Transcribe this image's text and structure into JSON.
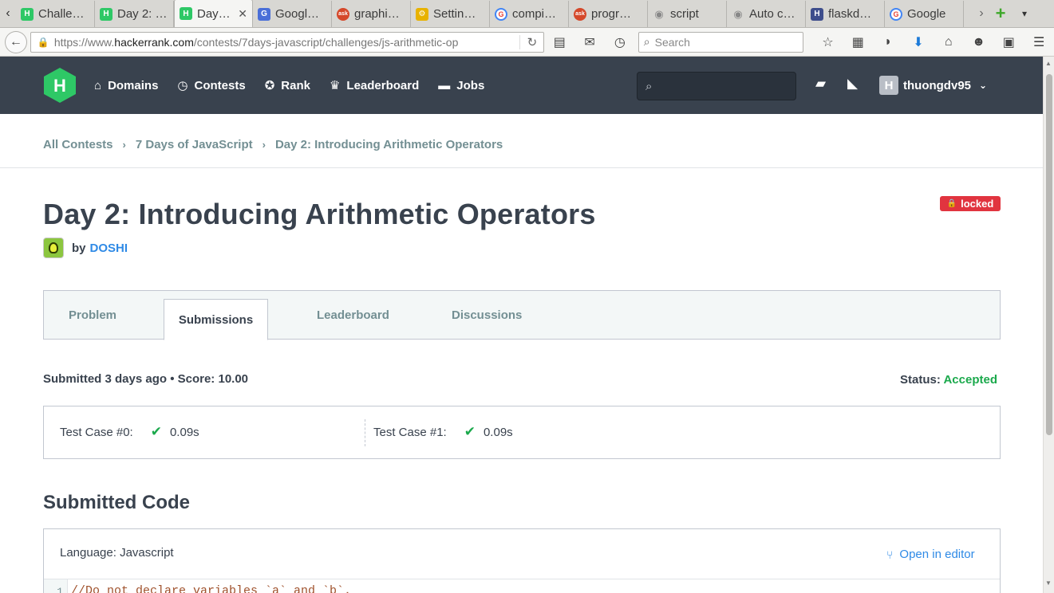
{
  "browser": {
    "tabs": [
      {
        "label": "Challe…",
        "icon": "hackerrank-icon"
      },
      {
        "label": "Day 2: …",
        "icon": "hackerrank-icon"
      },
      {
        "label": "Day…",
        "icon": "hackerrank-icon",
        "active": true
      },
      {
        "label": "Googl…",
        "icon": "google-docs-icon"
      },
      {
        "label": "graphi…",
        "icon": "askubuntu-icon"
      },
      {
        "label": "Settin…",
        "icon": "settings-icon"
      },
      {
        "label": "compi…",
        "icon": "google-icon"
      },
      {
        "label": "progr…",
        "icon": "askubuntu-icon"
      },
      {
        "label": "script",
        "icon": "github-icon"
      },
      {
        "label": "Auto c…",
        "icon": "github-icon"
      },
      {
        "label": "flaskd…",
        "icon": "flask-icon"
      },
      {
        "label": "Google",
        "icon": "google-icon"
      }
    ],
    "url_prefix": "https://www.",
    "url_domain": "hackerrank.com",
    "url_path": "/contests/7days-javascript/challenges/js-arithmetic-op",
    "search_placeholder": "Search"
  },
  "header": {
    "nav": [
      {
        "label": "Domains",
        "icon": "home-icon"
      },
      {
        "label": "Contests",
        "icon": "clock-icon"
      },
      {
        "label": "Rank",
        "icon": "medal-icon"
      },
      {
        "label": "Leaderboard",
        "icon": "trophy-icon"
      },
      {
        "label": "Jobs",
        "icon": "briefcase-icon"
      }
    ],
    "username": "thuongdv95"
  },
  "breadcrumb": [
    "All Contests",
    "7 Days of JavaScript",
    "Day 2: Introducing Arithmetic Operators"
  ],
  "challenge": {
    "title": "Day 2: Introducing Arithmetic Operators",
    "locked_label": "locked",
    "by_label": "by",
    "author": "DOSHI"
  },
  "tabs": [
    "Problem",
    "Submissions",
    "Leaderboard",
    "Discussions"
  ],
  "submission": {
    "summary": "Submitted 3 days ago • Score: 10.00",
    "status_label": "Status:",
    "status_value": "Accepted",
    "test_cases": [
      {
        "label": "Test Case #0:",
        "time": "0.09s"
      },
      {
        "label": "Test Case #1:",
        "time": "0.09s"
      }
    ]
  },
  "code": {
    "heading": "Submitted Code",
    "language": "Language: Javascript",
    "open_editor": "Open in editor",
    "line_number": "1",
    "first_line": "//Do not declare variables `a` and `b`."
  },
  "colors": {
    "header_bg": "#39424e",
    "accent_green": "#1ba94c",
    "link_blue": "#2f8ae6",
    "locked_red": "#e1343f"
  }
}
